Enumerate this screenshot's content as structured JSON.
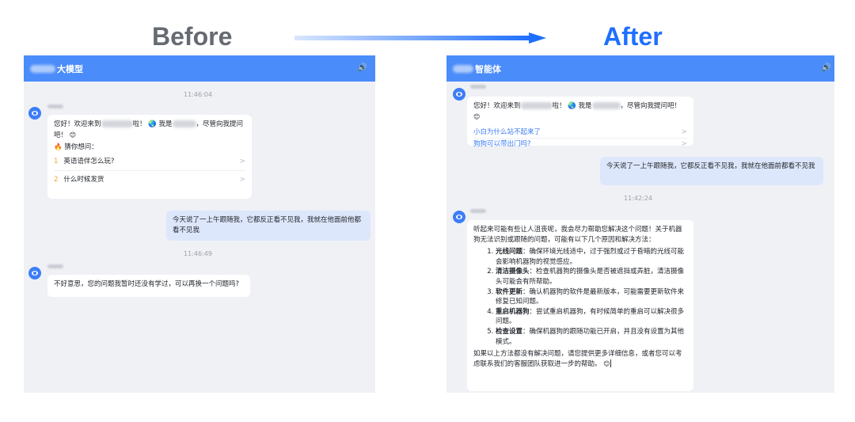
{
  "headings": {
    "before": "Before",
    "after": "After"
  },
  "before": {
    "title_suffix": "大模型",
    "ts1": "11:46:04",
    "greeting_a": "您好！欢迎来到",
    "greeting_b": "啦！",
    "greeting_c": "我是",
    "greeting_d": "，尽管向我提问吧！",
    "guess_label": "猜你想问：",
    "suggestions": [
      {
        "num": "1",
        "text": "英语语伴怎么玩?"
      },
      {
        "num": "2",
        "text": "什么时候发货"
      }
    ],
    "user_msg": "今天说了一上午跟随我，它都反正看不见我，我就在他面前他都看不见我",
    "ts2": "11:46:49",
    "bot_reply": "不好意思，您的问题我暂时还没有学过，可以再换一个问题吗?"
  },
  "after": {
    "title_suffix": "智能体",
    "greeting_a": "您好！欢迎来到",
    "greeting_b": "啦！",
    "greeting_c": "我是",
    "greeting_d": "，尽管向我提问吧！",
    "links": [
      "小白为什么站不起来了",
      "狗狗可以带出门吗?"
    ],
    "user_msg": "今天说了一上午跟随我，它都反正看不见我，我就在他面前都看不见我",
    "ts": "11:42:24",
    "intro": "听起来可能有些让人沮丧呢，我会尽力帮助您解决这个问题！关于机器狗无法识别或跟随的问题，可能有以下几个原因和解决方法：",
    "items": [
      {
        "bold": "光线问题",
        "text": "：确保环境光线适中，过于强烈或过于昏暗的光线可能会影响机器狗的视觉感应。"
      },
      {
        "bold": "清洁摄像头",
        "text": "：检查机器狗的摄像头是否被遮挡或弄脏，清洁摄像头可能会有所帮助。"
      },
      {
        "bold": "软件更新",
        "text": "：确认机器狗的软件是最新版本，可能需要更新软件来修复已知问题。"
      },
      {
        "bold": "重启机器狗",
        "text": "：尝试重启机器狗，有时候简单的重启可以解决很多问题。"
      },
      {
        "bold": "检查设置",
        "text": "：确保机器狗的跟随功能已开启，并且没有设置为其他模式。"
      }
    ],
    "outro": "如果以上方法都没有解决问题，请您提供更多详细信息，或者您可以考虑联系我们的客服团队获取进一步的帮助。"
  },
  "colors": {
    "topbar": "#4a8cfa",
    "accent": "#1f6fff",
    "panel_bg": "#f0f1f5",
    "user_bubble": "#dde7fb"
  }
}
